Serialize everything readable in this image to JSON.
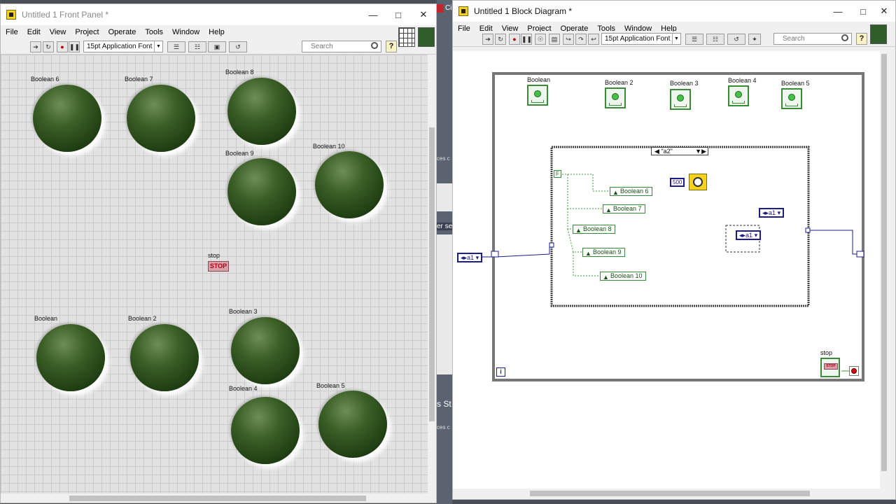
{
  "taskbar_fragments": {
    "a": "Ci",
    "b": "ces c",
    "c": "er se",
    "d": "s St",
    "e": "ces c"
  },
  "front_panel": {
    "title": "Untitled 1 Front Panel *",
    "menus": [
      "File",
      "Edit",
      "View",
      "Project",
      "Operate",
      "Tools",
      "Window",
      "Help"
    ],
    "font": "15pt Application Font",
    "search_placeholder": "Search",
    "help": "?",
    "leds": [
      {
        "label": "Boolean 6"
      },
      {
        "label": "Boolean 7"
      },
      {
        "label": "Boolean 8"
      },
      {
        "label": "Boolean 9"
      },
      {
        "label": "Boolean 10"
      },
      {
        "label": "Boolean"
      },
      {
        "label": "Boolean 2"
      },
      {
        "label": "Boolean 3"
      },
      {
        "label": "Boolean 4"
      },
      {
        "label": "Boolean 5"
      }
    ],
    "stop": {
      "label": "stop",
      "button": "STOP"
    }
  },
  "block_diagram": {
    "title": "Untitled 1 Block Diagram *",
    "menus": [
      "File",
      "Edit",
      "View",
      "Project",
      "Operate",
      "Tools",
      "Window",
      "Help"
    ],
    "font": "15pt Application Font",
    "search_placeholder": "Search",
    "help": "?",
    "terminals": [
      {
        "label": "Boolean"
      },
      {
        "label": "Boolean 2"
      },
      {
        "label": "Boolean 3"
      },
      {
        "label": "Boolean 4"
      },
      {
        "label": "Boolean 5"
      }
    ],
    "case_selector": "\"a2\"",
    "locals": [
      "Boolean 6",
      "Boolean 7",
      "Boolean 8",
      "Boolean 9",
      "Boolean 10"
    ],
    "false_const": "F",
    "wait_value": "500",
    "enum_consts": [
      "a1",
      "a1",
      "a1"
    ],
    "stop_label": "stop",
    "stop_glyph": "STOP",
    "iteration": "i"
  }
}
